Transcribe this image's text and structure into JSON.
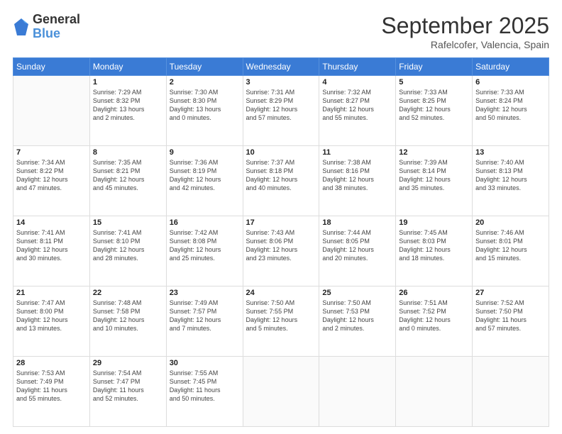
{
  "header": {
    "logo_general": "General",
    "logo_blue": "Blue",
    "month_title": "September 2025",
    "subtitle": "Rafelcofer, Valencia, Spain"
  },
  "days_of_week": [
    "Sunday",
    "Monday",
    "Tuesday",
    "Wednesday",
    "Thursday",
    "Friday",
    "Saturday"
  ],
  "weeks": [
    [
      {
        "day": "",
        "text": ""
      },
      {
        "day": "1",
        "text": "Sunrise: 7:29 AM\nSunset: 8:32 PM\nDaylight: 13 hours\nand 2 minutes."
      },
      {
        "day": "2",
        "text": "Sunrise: 7:30 AM\nSunset: 8:30 PM\nDaylight: 13 hours\nand 0 minutes."
      },
      {
        "day": "3",
        "text": "Sunrise: 7:31 AM\nSunset: 8:29 PM\nDaylight: 12 hours\nand 57 minutes."
      },
      {
        "day": "4",
        "text": "Sunrise: 7:32 AM\nSunset: 8:27 PM\nDaylight: 12 hours\nand 55 minutes."
      },
      {
        "day": "5",
        "text": "Sunrise: 7:33 AM\nSunset: 8:25 PM\nDaylight: 12 hours\nand 52 minutes."
      },
      {
        "day": "6",
        "text": "Sunrise: 7:33 AM\nSunset: 8:24 PM\nDaylight: 12 hours\nand 50 minutes."
      }
    ],
    [
      {
        "day": "7",
        "text": "Sunrise: 7:34 AM\nSunset: 8:22 PM\nDaylight: 12 hours\nand 47 minutes."
      },
      {
        "day": "8",
        "text": "Sunrise: 7:35 AM\nSunset: 8:21 PM\nDaylight: 12 hours\nand 45 minutes."
      },
      {
        "day": "9",
        "text": "Sunrise: 7:36 AM\nSunset: 8:19 PM\nDaylight: 12 hours\nand 42 minutes."
      },
      {
        "day": "10",
        "text": "Sunrise: 7:37 AM\nSunset: 8:18 PM\nDaylight: 12 hours\nand 40 minutes."
      },
      {
        "day": "11",
        "text": "Sunrise: 7:38 AM\nSunset: 8:16 PM\nDaylight: 12 hours\nand 38 minutes."
      },
      {
        "day": "12",
        "text": "Sunrise: 7:39 AM\nSunset: 8:14 PM\nDaylight: 12 hours\nand 35 minutes."
      },
      {
        "day": "13",
        "text": "Sunrise: 7:40 AM\nSunset: 8:13 PM\nDaylight: 12 hours\nand 33 minutes."
      }
    ],
    [
      {
        "day": "14",
        "text": "Sunrise: 7:41 AM\nSunset: 8:11 PM\nDaylight: 12 hours\nand 30 minutes."
      },
      {
        "day": "15",
        "text": "Sunrise: 7:41 AM\nSunset: 8:10 PM\nDaylight: 12 hours\nand 28 minutes."
      },
      {
        "day": "16",
        "text": "Sunrise: 7:42 AM\nSunset: 8:08 PM\nDaylight: 12 hours\nand 25 minutes."
      },
      {
        "day": "17",
        "text": "Sunrise: 7:43 AM\nSunset: 8:06 PM\nDaylight: 12 hours\nand 23 minutes."
      },
      {
        "day": "18",
        "text": "Sunrise: 7:44 AM\nSunset: 8:05 PM\nDaylight: 12 hours\nand 20 minutes."
      },
      {
        "day": "19",
        "text": "Sunrise: 7:45 AM\nSunset: 8:03 PM\nDaylight: 12 hours\nand 18 minutes."
      },
      {
        "day": "20",
        "text": "Sunrise: 7:46 AM\nSunset: 8:01 PM\nDaylight: 12 hours\nand 15 minutes."
      }
    ],
    [
      {
        "day": "21",
        "text": "Sunrise: 7:47 AM\nSunset: 8:00 PM\nDaylight: 12 hours\nand 13 minutes."
      },
      {
        "day": "22",
        "text": "Sunrise: 7:48 AM\nSunset: 7:58 PM\nDaylight: 12 hours\nand 10 minutes."
      },
      {
        "day": "23",
        "text": "Sunrise: 7:49 AM\nSunset: 7:57 PM\nDaylight: 12 hours\nand 7 minutes."
      },
      {
        "day": "24",
        "text": "Sunrise: 7:50 AM\nSunset: 7:55 PM\nDaylight: 12 hours\nand 5 minutes."
      },
      {
        "day": "25",
        "text": "Sunrise: 7:50 AM\nSunset: 7:53 PM\nDaylight: 12 hours\nand 2 minutes."
      },
      {
        "day": "26",
        "text": "Sunrise: 7:51 AM\nSunset: 7:52 PM\nDaylight: 12 hours\nand 0 minutes."
      },
      {
        "day": "27",
        "text": "Sunrise: 7:52 AM\nSunset: 7:50 PM\nDaylight: 11 hours\nand 57 minutes."
      }
    ],
    [
      {
        "day": "28",
        "text": "Sunrise: 7:53 AM\nSunset: 7:49 PM\nDaylight: 11 hours\nand 55 minutes."
      },
      {
        "day": "29",
        "text": "Sunrise: 7:54 AM\nSunset: 7:47 PM\nDaylight: 11 hours\nand 52 minutes."
      },
      {
        "day": "30",
        "text": "Sunrise: 7:55 AM\nSunset: 7:45 PM\nDaylight: 11 hours\nand 50 minutes."
      },
      {
        "day": "",
        "text": ""
      },
      {
        "day": "",
        "text": ""
      },
      {
        "day": "",
        "text": ""
      },
      {
        "day": "",
        "text": ""
      }
    ]
  ]
}
